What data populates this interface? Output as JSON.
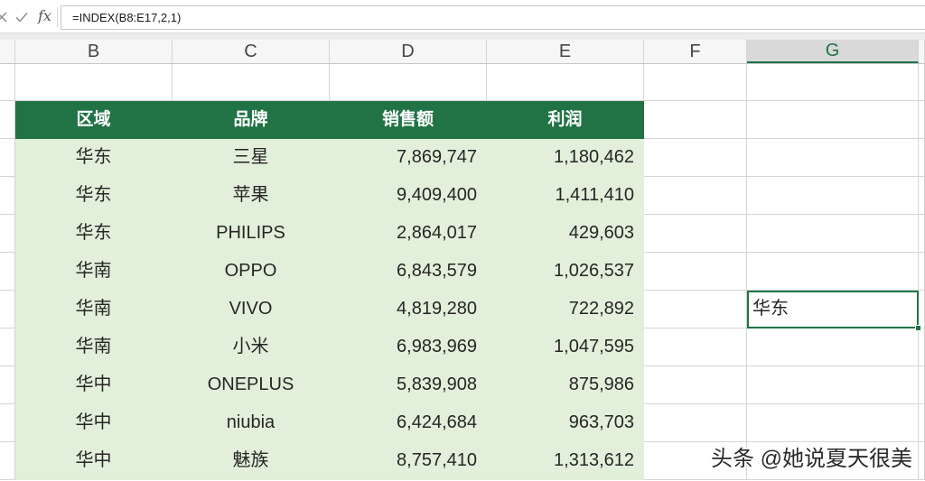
{
  "formula_bar": {
    "icons": {
      "cancel": "close-icon",
      "enter": "check-icon",
      "insert_function": "fx-icon"
    },
    "fx_label": "fx",
    "formula": "=INDEX(B8:E17,2,1)"
  },
  "columns": [
    {
      "label": "B"
    },
    {
      "label": "C"
    },
    {
      "label": "D"
    },
    {
      "label": "E"
    },
    {
      "label": "F"
    },
    {
      "label": "G",
      "selected": true
    }
  ],
  "table": {
    "headers": [
      "区域",
      "品牌",
      "销售额",
      "利润"
    ],
    "rows": [
      [
        "华东",
        "三星",
        "7,869,747",
        "1,180,462"
      ],
      [
        "华东",
        "苹果",
        "9,409,400",
        "1,411,410"
      ],
      [
        "华东",
        "PHILIPS",
        "2,864,017",
        "429,603"
      ],
      [
        "华南",
        "OPPO",
        "6,843,579",
        "1,026,537"
      ],
      [
        "华南",
        "VIVO",
        "4,819,280",
        "722,892"
      ],
      [
        "华南",
        "小米",
        "6,983,969",
        "1,047,595"
      ],
      [
        "华中",
        "ONEPLUS",
        "5,839,908",
        "875,986"
      ],
      [
        "华中",
        "niubia",
        "6,424,684",
        "963,703"
      ],
      [
        "华中",
        "魅族",
        "8,757,410",
        "1,313,612"
      ]
    ]
  },
  "active_cell": {
    "value": "华东"
  },
  "watermark": "头条 @她说夏天很美",
  "colors": {
    "accent": "#217346",
    "table_header_fill": "#217346",
    "table_header_text": "#ffffff",
    "table_body_fill": "#e2efda",
    "gridline": "#d4d4d4"
  }
}
